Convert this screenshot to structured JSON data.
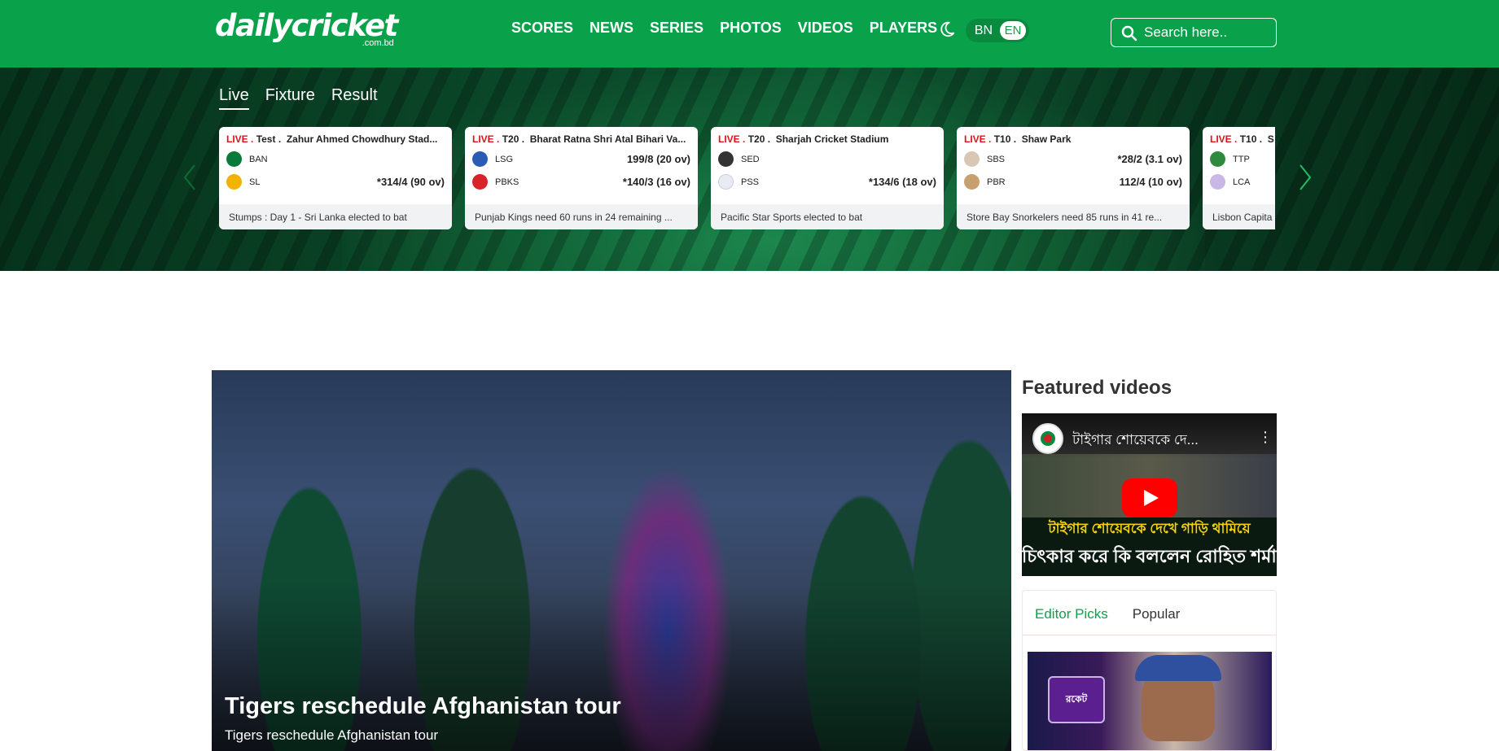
{
  "header": {
    "logo_main": "dailycricket",
    "logo_sub": ".com.bd",
    "nav": [
      "SCORES",
      "NEWS",
      "SERIES",
      "PHOTOS",
      "VIDEOS",
      "PLAYERS"
    ],
    "lang_bn": "BN",
    "lang_en": "EN",
    "search_placeholder": "Search here..",
    "icons": [
      "moon-icon",
      "search-icon"
    ]
  },
  "matches": {
    "tabs": [
      "Live",
      "Fixture",
      "Result"
    ],
    "active_tab": "Live",
    "cards": [
      {
        "status": "LIVE",
        "format": "Test",
        "venue": "Zahur Ahmed Chowdhury Stad...",
        "team1": "BAN",
        "score1": "",
        "team2": "SL",
        "score2": "*314/4 (90 ov)",
        "note": "Stumps : Day 1 - Sri Lanka elected to bat",
        "color1": "#0a7a3a",
        "color2": "#f0b400"
      },
      {
        "status": "LIVE",
        "format": "T20",
        "venue": "Bharat Ratna Shri Atal Bihari Va...",
        "team1": "LSG",
        "score1": "199/8 (20 ov)",
        "team2": "PBKS",
        "score2": "*140/3 (16 ov)",
        "note": "Punjab Kings need 60 runs in 24 remaining ...",
        "color1": "#2a5bb5",
        "color2": "#d8232a"
      },
      {
        "status": "LIVE",
        "format": "T20",
        "venue": "Sharjah Cricket Stadium",
        "team1": "SED",
        "score1": "",
        "team2": "PSS",
        "score2": "*134/6 (18 ov)",
        "note": "Pacific Star Sports elected to bat",
        "color1": "#333333",
        "color2": "#e8ecf2"
      },
      {
        "status": "LIVE",
        "format": "T10",
        "venue": "Shaw Park",
        "team1": "SBS",
        "score1": "*28/2 (3.1 ov)",
        "team2": "PBR",
        "score2": "112/4 (10 ov)",
        "note": "Store Bay Snorkelers need 85 runs in 41 re...",
        "color1": "#d9c7b5",
        "color2": "#c8a070"
      },
      {
        "status": "LIVE",
        "format": "T10",
        "venue": "S",
        "team1": "TTP",
        "score1": "",
        "team2": "LCA",
        "score2": "",
        "note": "Lisbon Capita",
        "color1": "#2e8b3d",
        "color2": "#c9b8e6"
      }
    ]
  },
  "hero": {
    "title": "Tigers reschedule Afghanistan tour",
    "subtitle": "Tigers reschedule Afghanistan tour"
  },
  "featured": {
    "title": "Featured videos",
    "video_title": "টাইগার শোয়েবকে দে...",
    "caption_line1": "টাইগার শোয়েবকে দেখে গাড়ি থামিয়ে",
    "caption_line2": "চিৎকার করে কি বললেন রোহিত শর্মা ?"
  },
  "picks": {
    "tabs": [
      "Editor Picks",
      "Popular"
    ],
    "active_tab": "Editor Picks",
    "badge_text": "রকেট"
  },
  "colors": {
    "brand_green": "#0aa14b",
    "live_red": "#e0101a"
  }
}
